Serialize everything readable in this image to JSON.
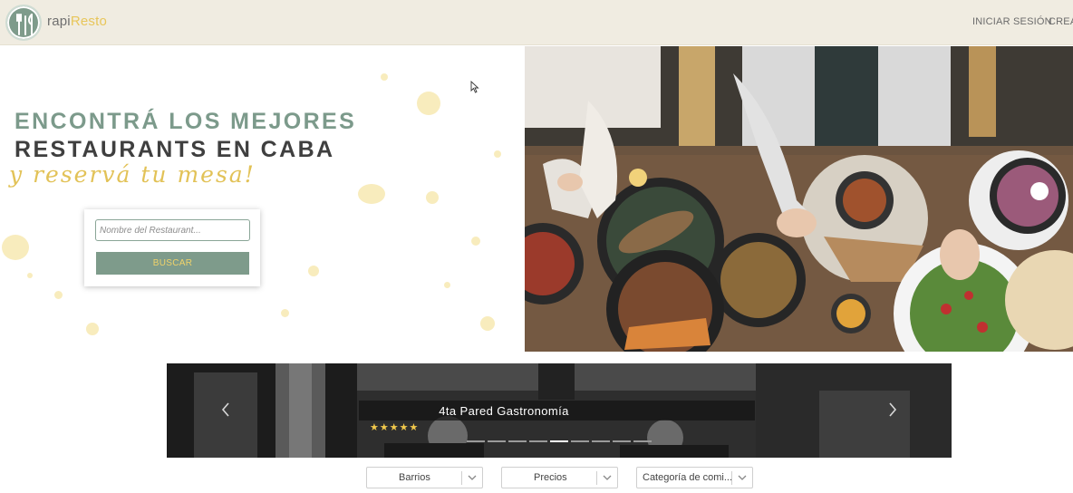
{
  "header": {
    "logo_light": "rapi",
    "logo_accent": "Resto",
    "nav_login": "INICIAR SESIÓN",
    "nav_create": "CREAR"
  },
  "hero": {
    "line1": "ENCONTRÁ LOS MEJORES",
    "line2": "RESTAURANTS EN CABA",
    "line3": "y reservá tu mesa!"
  },
  "search": {
    "placeholder": "Nombre del Restaurant...",
    "value": "",
    "button_label": "BUSCAR"
  },
  "carousel": {
    "title": "4ta Pared Gastronomía",
    "rating": 5,
    "stars": "★★★★★",
    "slide_count": 9,
    "active_slide": 5
  },
  "filters": {
    "neighborhoods": "Barrios",
    "prices": "Precios",
    "category": "Categoría de comi..."
  },
  "colors": {
    "header_bg": "#f0ece1",
    "sage": "#7e9b8b",
    "mustard": "#e2c257",
    "dark_text": "#3f3f3f"
  },
  "icons": [
    "fork-knife-logo-icon",
    "chevron-left-icon",
    "chevron-right-icon",
    "chevron-down-icon",
    "mouse-cursor-icon"
  ]
}
